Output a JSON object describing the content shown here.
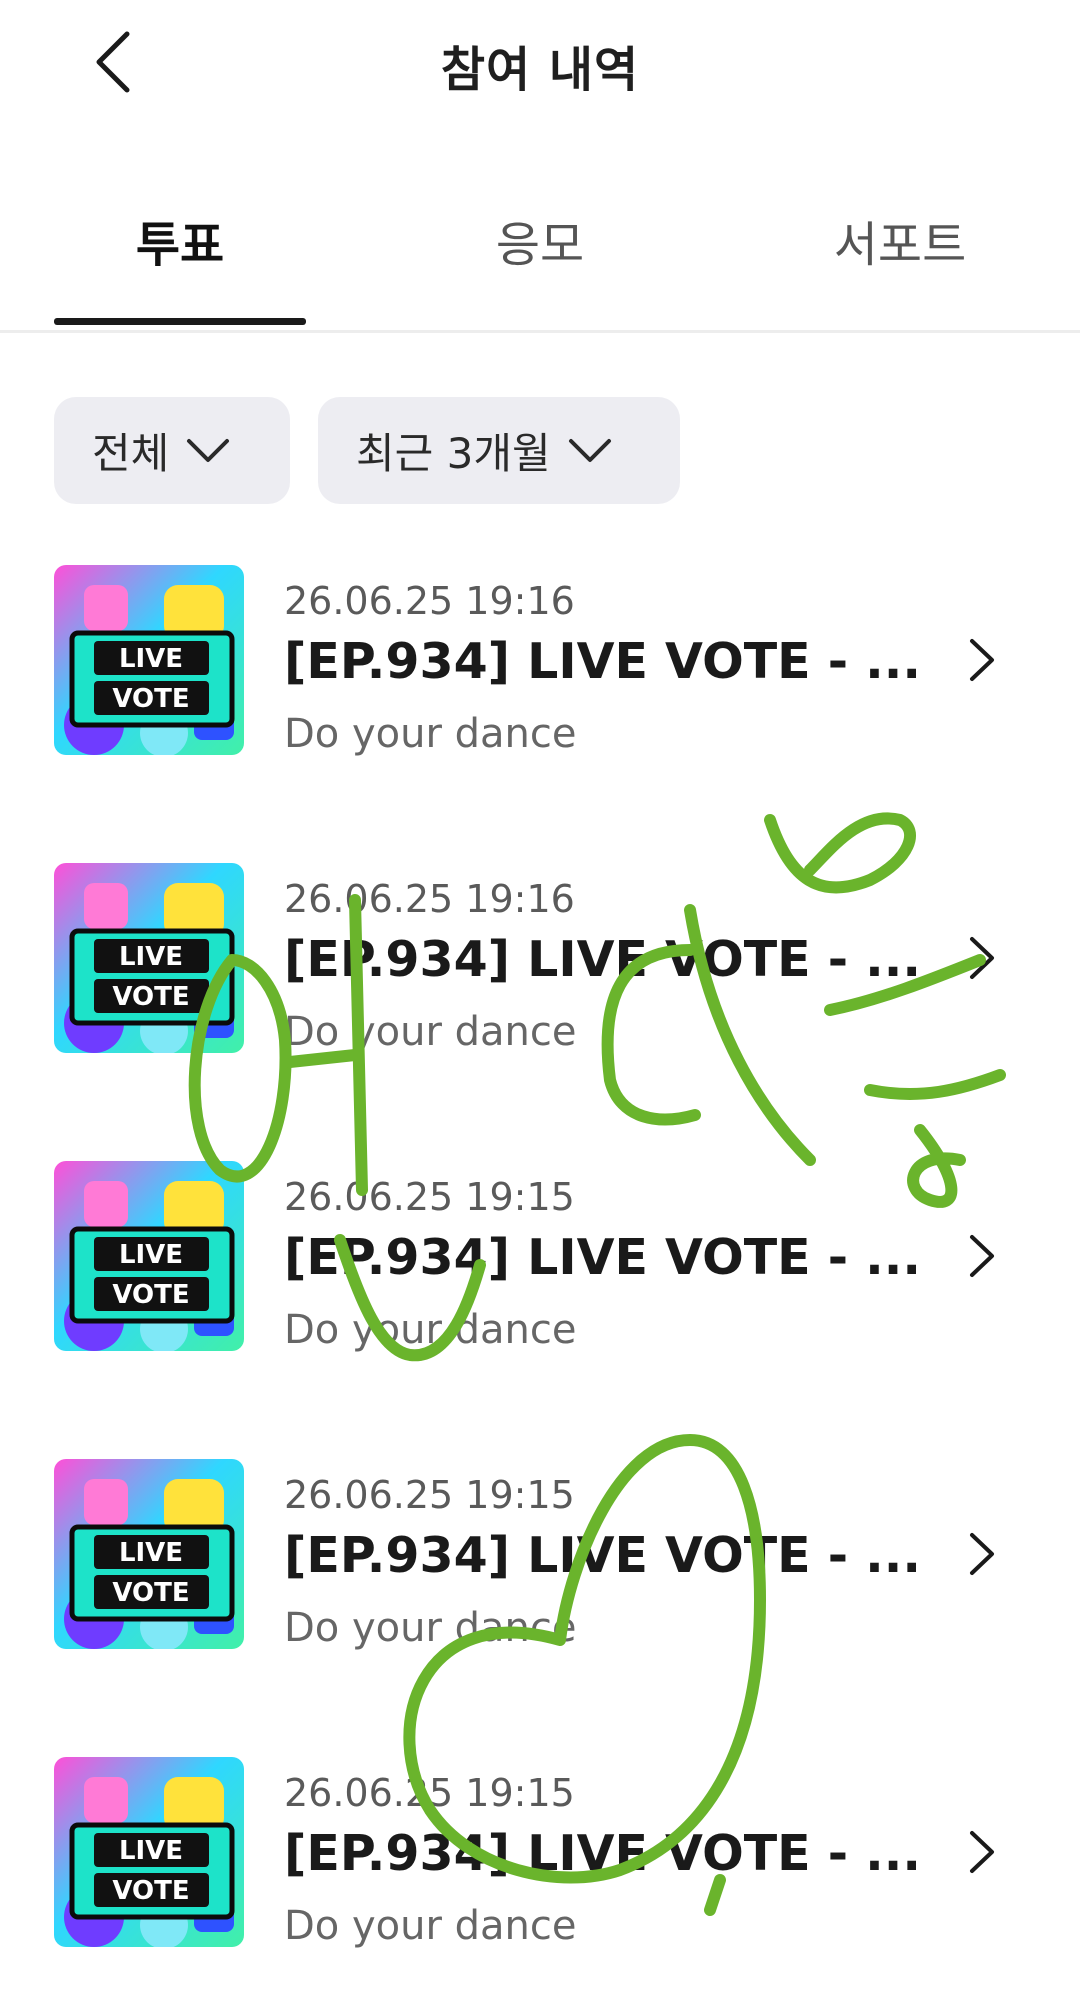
{
  "header": {
    "title": "참여 내역",
    "back_icon": "chevron-left-icon"
  },
  "tabs": [
    {
      "label": "투표",
      "active": true
    },
    {
      "label": "응모",
      "active": false
    },
    {
      "label": "서포트",
      "active": false
    }
  ],
  "filters": [
    {
      "label": "전체",
      "icon": "chevron-down-icon"
    },
    {
      "label": "최근 3개월",
      "icon": "chevron-down-icon"
    }
  ],
  "thumbnail": {
    "line1": "LIVE",
    "line2": "VOTE"
  },
  "items": [
    {
      "date": "26.06.25 19:16",
      "title": "[EP.934] LIVE VOTE - ...",
      "subtitle": "Do your dance"
    },
    {
      "date": "26.06.25 19:16",
      "title": "[EP.934] LIVE VOTE - ...",
      "subtitle": "Do your dance"
    },
    {
      "date": "26.06.25 19:15",
      "title": "[EP.934] LIVE VOTE - ...",
      "subtitle": "Do your dance"
    },
    {
      "date": "26.06.25 19:15",
      "title": "[EP.934] LIVE VOTE - ...",
      "subtitle": "Do your dance"
    },
    {
      "date": "26.06.25 19:15",
      "title": "[EP.934] LIVE VOTE - ...",
      "subtitle": "Do your dance"
    }
  ],
  "colors": {
    "scribble": "#6ab42c",
    "tab_active": "#111111",
    "filter_bg": "#ededf2"
  }
}
